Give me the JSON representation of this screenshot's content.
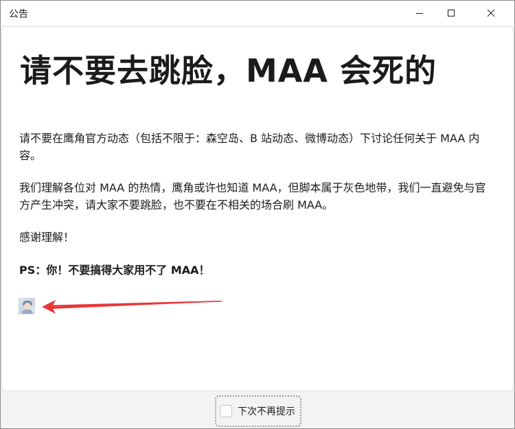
{
  "window": {
    "title": "公告"
  },
  "announcement": {
    "headline": "请不要去跳脸，MAA 会死的",
    "paragraphs": [
      "请不要在鹰角官方动态（包括不限于：森空岛、B 站动态、微博动态）下讨论任何关于 MAA 内容。",
      "我们理解各位对 MAA 的热情，鹰角或许也知道 MAA，但脚本属于灰色地带，我们一直避免与官方产生冲突，请大家不要跳脸，也不要在不相关的场合刷 MAA。",
      "感谢理解！",
      "PS：你！不要搞得大家用不了 MAA！"
    ],
    "emoji_icon": "sticker-image-icon",
    "arrow_color": "#e8383a"
  },
  "footer": {
    "dont_show_again_label": "下次不再提示",
    "checked": false
  }
}
